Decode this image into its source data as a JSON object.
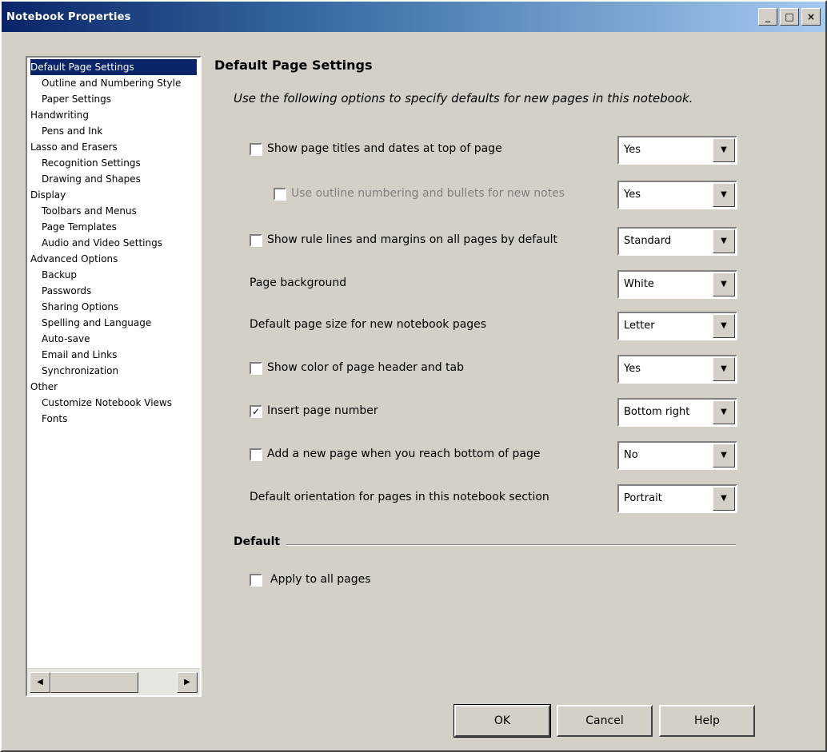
{
  "window": {
    "title": "Notebook Properties",
    "controls": {
      "minimize": "_",
      "maximize": "□",
      "close": "×"
    }
  },
  "tree": {
    "items": [
      {
        "label": "Default Page Settings",
        "level": 0,
        "selected": true
      },
      {
        "label": "Outline and Numbering Style",
        "level": 1
      },
      {
        "label": "Paper Settings",
        "level": 1
      },
      {
        "label": "Handwriting",
        "level": 0
      },
      {
        "label": "Pens and Ink",
        "level": 1
      },
      {
        "label": "Lasso and Erasers",
        "level": 0
      },
      {
        "label": "Recognition Settings",
        "level": 1
      },
      {
        "label": "Drawing and Shapes",
        "level": 1
      },
      {
        "label": "Display",
        "level": 0
      },
      {
        "label": "Toolbars and Menus",
        "level": 1
      },
      {
        "label": "Page Templates",
        "level": 1
      },
      {
        "label": "Audio and Video Settings",
        "level": 1
      },
      {
        "label": "Advanced Options",
        "level": 0
      },
      {
        "label": "Backup",
        "level": 1
      },
      {
        "label": "Passwords",
        "level": 1
      },
      {
        "label": "Sharing Options",
        "level": 1
      },
      {
        "label": "Spelling and Language",
        "level": 1
      },
      {
        "label": "Auto-save",
        "level": 1
      },
      {
        "label": "Email and Links",
        "level": 1
      },
      {
        "label": "Synchronization",
        "level": 1
      },
      {
        "label": "Other",
        "level": 0
      },
      {
        "label": "Customize Notebook Views",
        "level": 1
      },
      {
        "label": "Fonts",
        "level": 1
      }
    ]
  },
  "content": {
    "section_title": "Default Page Settings",
    "description": "Use the following options to specify defaults for new pages in this notebook.",
    "settings": [
      {
        "label": "Show page titles and dates at top of page",
        "value": "Yes",
        "has_checkbox": true,
        "checked": false,
        "indent": 0,
        "disabled": false
      },
      {
        "label": "Use outline numbering and bullets for new notes",
        "value": "Yes",
        "has_checkbox": true,
        "checked": false,
        "indent": 1,
        "disabled": true
      },
      {
        "label": "Show rule lines and margins on all pages by default",
        "value": "Standard",
        "has_checkbox": true,
        "checked": false,
        "indent": 0,
        "disabled": false
      },
      {
        "label": "Page background",
        "value": "White",
        "has_checkbox": false,
        "checked": false,
        "indent": 0,
        "disabled": false
      },
      {
        "label": "Default page size for new notebook pages",
        "value": "Letter",
        "has_checkbox": false,
        "checked": false,
        "indent": 0,
        "disabled": false
      },
      {
        "label": "Show color of page header and tab",
        "value": "Yes",
        "has_checkbox": true,
        "checked": false,
        "indent": 0,
        "disabled": false
      },
      {
        "label": "Insert page number",
        "value": "Bottom right",
        "has_checkbox": true,
        "checked": true,
        "indent": 0,
        "disabled": false
      },
      {
        "label": "Add a new page when you reach bottom of page",
        "value": "No",
        "has_checkbox": true,
        "checked": false,
        "indent": 0,
        "disabled": false
      },
      {
        "label": "Default orientation for pages in this notebook section",
        "value": "Portrait",
        "has_checkbox": false,
        "checked": false,
        "indent": 0,
        "disabled": false
      }
    ],
    "group_label": "Default",
    "footer_checkbox_label": "Apply to all pages"
  },
  "buttons": {
    "ok": "OK",
    "cancel": "Cancel",
    "help": "Help"
  }
}
